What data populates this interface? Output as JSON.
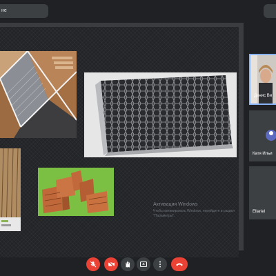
{
  "meeting": {
    "title_fragment": "не"
  },
  "presentation": {
    "watermark": {
      "title": "Активация Windows",
      "subtitle": "Чтобы активировать Windows, перейдите в раздел \"Параметры\"."
    }
  },
  "participants": [
    {
      "name": "Денис Ви",
      "active_speaker": true
    },
    {
      "name": "Катя Ильи",
      "active_speaker": false
    },
    {
      "name": "Ellariel",
      "active_speaker": false
    }
  ],
  "controls": {
    "mic": {
      "state": "muted",
      "icon": "mic-off-icon",
      "color": "#ea4335"
    },
    "camera": {
      "state": "off",
      "icon": "camera-off-icon",
      "color": "#ea4335"
    },
    "raise_hand": {
      "icon": "hand-icon"
    },
    "present": {
      "icon": "present-screen-icon"
    },
    "more": {
      "icon": "more-vert-icon"
    },
    "end_call": {
      "icon": "end-call-icon",
      "color": "#ea4335"
    }
  },
  "colors": {
    "background": "#202124",
    "tile": "#3c4043",
    "active_border": "#8ab4f8",
    "danger": "#ea4335"
  }
}
